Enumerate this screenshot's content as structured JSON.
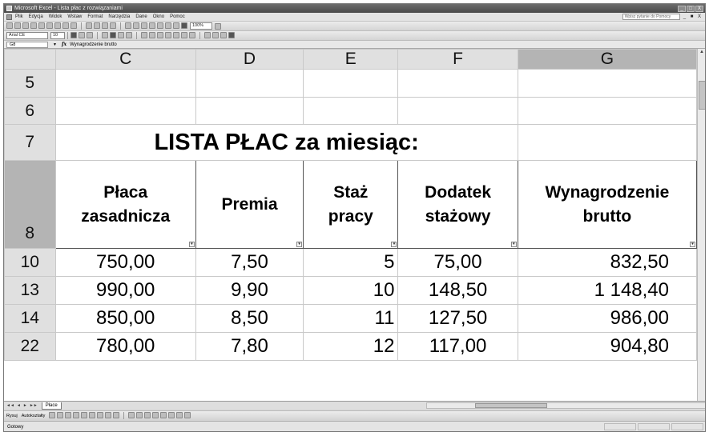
{
  "window": {
    "title": "Microsoft Excel - Lista płac z rozwiązaniami",
    "buttons": [
      "_",
      "□",
      "X"
    ]
  },
  "menu": {
    "items": [
      "Plik",
      "Edycja",
      "Widok",
      "Wstaw",
      "Format",
      "Narzędzia",
      "Dane",
      "Okno",
      "Pomoc"
    ],
    "help_placeholder": "Wpisz pytanie do Pomocy",
    "doc_controls": "_ ■ X"
  },
  "toolbar": {
    "zoom": "100%",
    "font": "Arial CE",
    "font_size": "10"
  },
  "formula_bar": {
    "name_box": "G8",
    "fx": "fx",
    "content": "Wynagrodzenie brutto"
  },
  "sheet": {
    "columns": [
      {
        "label": "C",
        "selected": false
      },
      {
        "label": "D",
        "selected": false
      },
      {
        "label": "E",
        "selected": false
      },
      {
        "label": "F",
        "selected": false
      },
      {
        "label": "G",
        "selected": true
      }
    ],
    "title": "LISTA PŁAC za miesiąc:",
    "headers": {
      "c": [
        "Płaca",
        "zasadnicza"
      ],
      "d": [
        "Premia"
      ],
      "e": [
        "Staż",
        "pracy"
      ],
      "f": [
        "Dodatek",
        "stażowy"
      ],
      "g": [
        "Wynagrodzenie",
        "brutto"
      ]
    },
    "rows": [
      {
        "num": "5"
      },
      {
        "num": "6"
      },
      {
        "num": "7"
      },
      {
        "num": "8"
      },
      {
        "num": "10",
        "c": "750,00",
        "d": "7,50",
        "e": "5",
        "f": "75,00",
        "g": "832,50"
      },
      {
        "num": "13",
        "c": "990,00",
        "d": "9,90",
        "e": "10",
        "f": "148,50",
        "g": "1 148,40"
      },
      {
        "num": "14",
        "c": "850,00",
        "d": "8,50",
        "e": "11",
        "f": "127,50",
        "g": "986,00"
      },
      {
        "num": "22",
        "c": "780,00",
        "d": "7,80",
        "e": "12",
        "f": "117,00",
        "g": "904,80"
      }
    ]
  },
  "tabs": {
    "nav": [
      "◄◄",
      "◄",
      "►",
      "►►"
    ],
    "active": "Płace"
  },
  "drawbar": {
    "draw_label": "Rysuj",
    "autoshapes_label": "Autokształty"
  },
  "status": {
    "text": "Gotowy"
  }
}
